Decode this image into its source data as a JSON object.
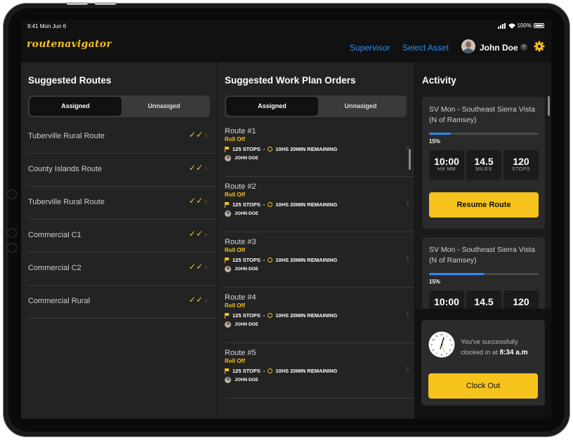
{
  "status_bar": {
    "time": "9:41  Mon Jun 6",
    "battery": "100%"
  },
  "header": {
    "logo": "routenavigator",
    "supervisor_link": "Supervisor",
    "select_asset_link": "Select Asset",
    "user_name": "John Doe"
  },
  "routes": {
    "title": "Suggested Routes",
    "tab_assigned": "Assigned",
    "tab_unassigned": "Unnasiged",
    "items": [
      {
        "name": "Tuberville  Rural Route"
      },
      {
        "name": "County Islands Route"
      },
      {
        "name": "Tuberville  Rural Route"
      },
      {
        "name": "Commercial C1"
      },
      {
        "name": "Commercial C2"
      },
      {
        "name": "Commercial Rural"
      }
    ]
  },
  "work_orders": {
    "title": "Suggested Work Plan Orders",
    "tab_assigned": "Assigned",
    "tab_unassigned": "Unnasiged",
    "items": [
      {
        "title": "Route #1",
        "type": "Roll Off",
        "stops": "125 STOPS",
        "sep": "-",
        "remaining": "10HS 20MIN REMAINING",
        "driver": "JOHN DOE"
      },
      {
        "title": "Route #2",
        "type": "Roll Off",
        "stops": "125 STOPS",
        "sep": "-",
        "remaining": "10HS 20MIN REMAINING",
        "driver": "JOHN DOE"
      },
      {
        "title": "Route #3",
        "type": "Roll Off",
        "stops": "125 STOPS",
        "sep": "-",
        "remaining": "10HS 20MIN REMAINING",
        "driver": "JOHN DOE"
      },
      {
        "title": "Route #4",
        "type": "Roll Off",
        "stops": "125 STOPS",
        "sep": "-",
        "remaining": "10HS 20MIN REMAINING",
        "driver": "JOHN DOE"
      },
      {
        "title": "Route #5",
        "type": "Roll Off",
        "stops": "125 STOPS",
        "sep": "-",
        "remaining": "10HS 20MIN REMAINING",
        "driver": "JOHN DOE"
      }
    ]
  },
  "activity": {
    "title": "Activity",
    "cards": [
      {
        "title": "SV Mon - Southeast Sierra Vista (N of Ramsey)",
        "progress_pct": "15%",
        "progress": 0.2,
        "time_val": "10:00",
        "time_lbl": "HH  MM",
        "miles_val": "14.5",
        "miles_lbl": "MILES",
        "stops_val": "120",
        "stops_lbl": "STOPS",
        "button": "Resume Route"
      },
      {
        "title": "SV Mon - Southeast Sierra Vista (N of Ramsey)",
        "progress_pct": "15%",
        "progress": 0.5,
        "time_val": "10:00",
        "miles_val": "14.5",
        "stops_val": "120"
      }
    ],
    "clock": {
      "line1": "You've successfully",
      "line2": "clocked in at",
      "time": "8:34 a.m",
      "button": "Clock Out"
    }
  },
  "colors": {
    "accent": "#f6c21c",
    "link": "#2d8cff",
    "panel": "#232323"
  }
}
